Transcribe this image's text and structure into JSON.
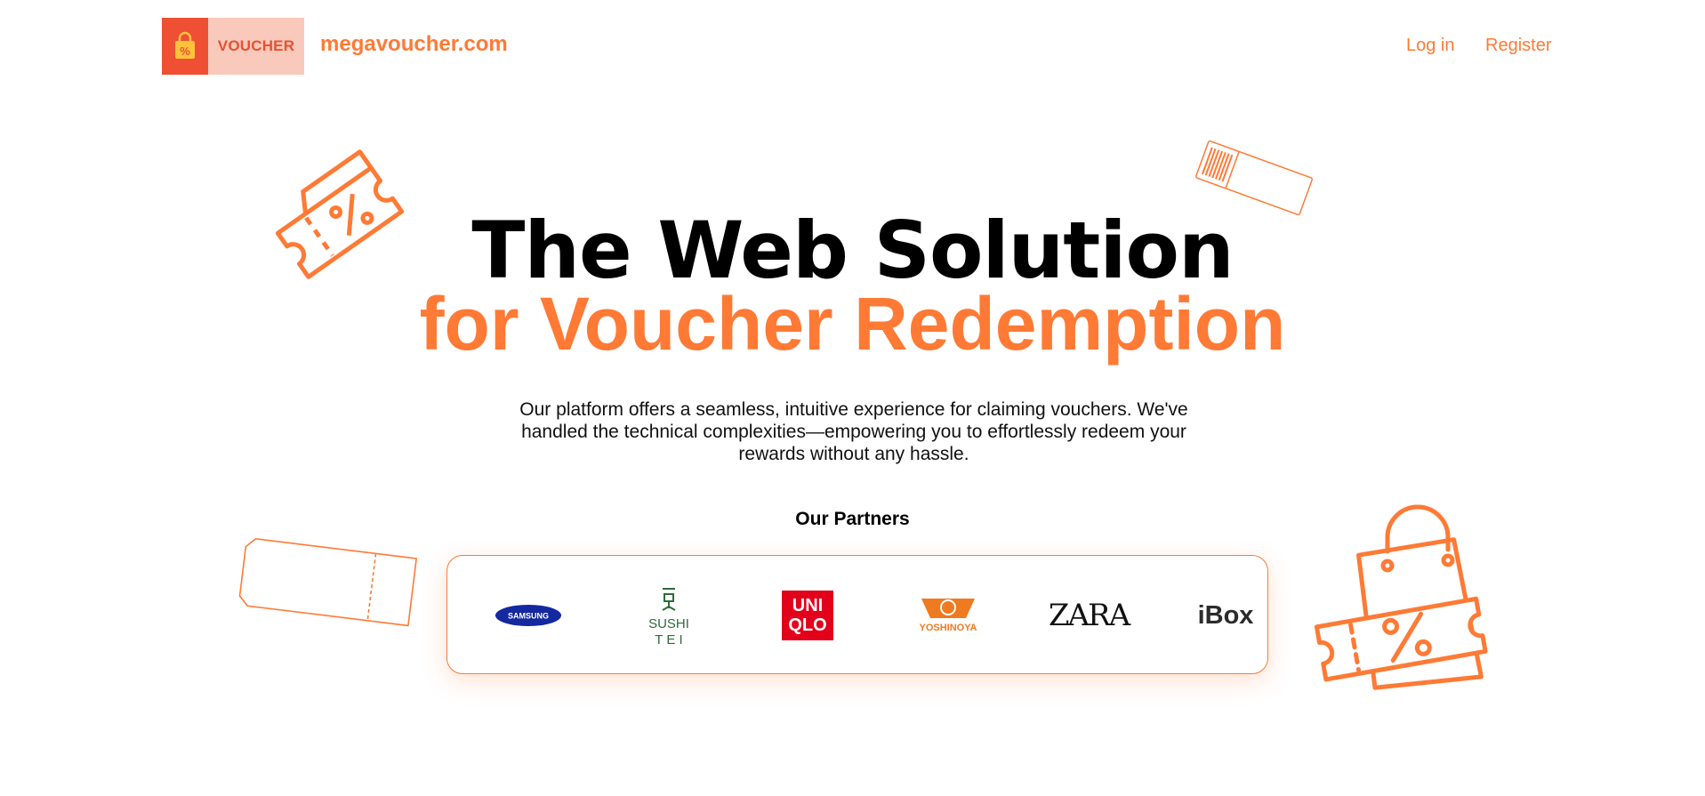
{
  "header": {
    "logo_text": "VOUCHER",
    "site_name": "megavoucher.com",
    "login_label": "Log in",
    "register_label": "Register"
  },
  "hero": {
    "title_line1": "The Web Solution",
    "title_line2": "for Voucher Redemption",
    "description": "Our platform offers a seamless, intuitive experience for claiming vouchers. We've handled the technical complexities—empowering you to effortlessly redeem your rewards without any hassle."
  },
  "partners": {
    "title": "Our Partners",
    "logos": [
      {
        "name": "SAMSUNG",
        "text": "SAMSUNG"
      },
      {
        "name": "SUSHI TEI",
        "text": "SUSHI"
      },
      {
        "name": "UNIQLO",
        "text": "UNI"
      },
      {
        "name": "YOSHINOYA",
        "text": "YOSHINOYA"
      },
      {
        "name": "ZARA",
        "text": "ZARA"
      },
      {
        "name": "iBox",
        "text": "iBox"
      }
    ],
    "logo_texts": {
      "sushi_line2": "T E I",
      "uniqlo_line2": "QLO"
    }
  },
  "colors": {
    "accent": "#ff7a35",
    "logo_red": "#ef4f33",
    "logo_pink": "#f9c9bb",
    "samsung_blue": "#1428a0",
    "uniqlo_red": "#e2001a",
    "sushi_green": "#2e6b3a"
  },
  "icons": [
    "shopping-bag-icon",
    "percent-ticket-icon",
    "barcode-ticket-icon",
    "blank-ticket-icon",
    "shopping-bag-ticket-icon"
  ]
}
